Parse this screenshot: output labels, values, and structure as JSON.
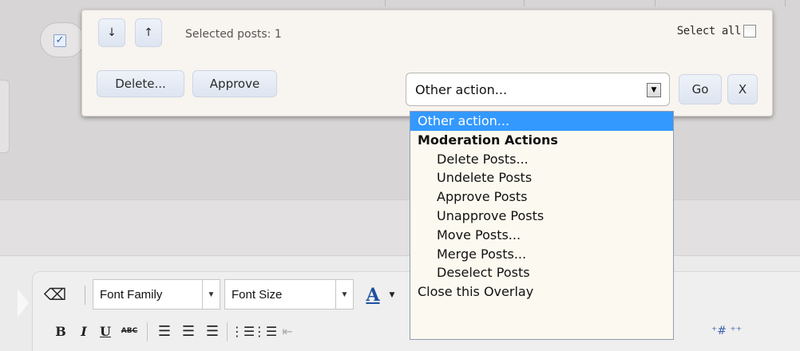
{
  "overlay": {
    "move_down_button": "↓",
    "move_up_button": "↑",
    "selected_posts_text": "Selected posts: 1",
    "select_all_label": "Select all",
    "delete_button": "Delete...",
    "approve_button": "Approve",
    "action_select_value": "Other action...",
    "go_button": "Go",
    "close_button": "X"
  },
  "dropdown": {
    "options": [
      {
        "label": "Other action...",
        "selected": true
      },
      {
        "label": "Moderation Actions",
        "group": true
      },
      {
        "label": "Delete Posts...",
        "indent": true
      },
      {
        "label": "Undelete Posts",
        "indent": true
      },
      {
        "label": "Approve Posts",
        "indent": true
      },
      {
        "label": "Unapprove Posts",
        "indent": true
      },
      {
        "label": "Move Posts...",
        "indent": true
      },
      {
        "label": "Merge Posts...",
        "indent": true
      },
      {
        "label": "Deselect Posts",
        "indent": true
      },
      {
        "label": "Close this Overlay"
      }
    ]
  },
  "editor": {
    "font_family_label": "Font Family",
    "font_size_label": "Font Size",
    "font_color_glyph": "A",
    "bold_glyph": "B",
    "italic_glyph": "I",
    "underline_glyph": "U",
    "strike_glyph": "ABC"
  },
  "colors": {
    "selected_option": "#3399ff",
    "panel_bg": "#f8f4ef",
    "dropdown_bg": "#fcfaf0"
  }
}
